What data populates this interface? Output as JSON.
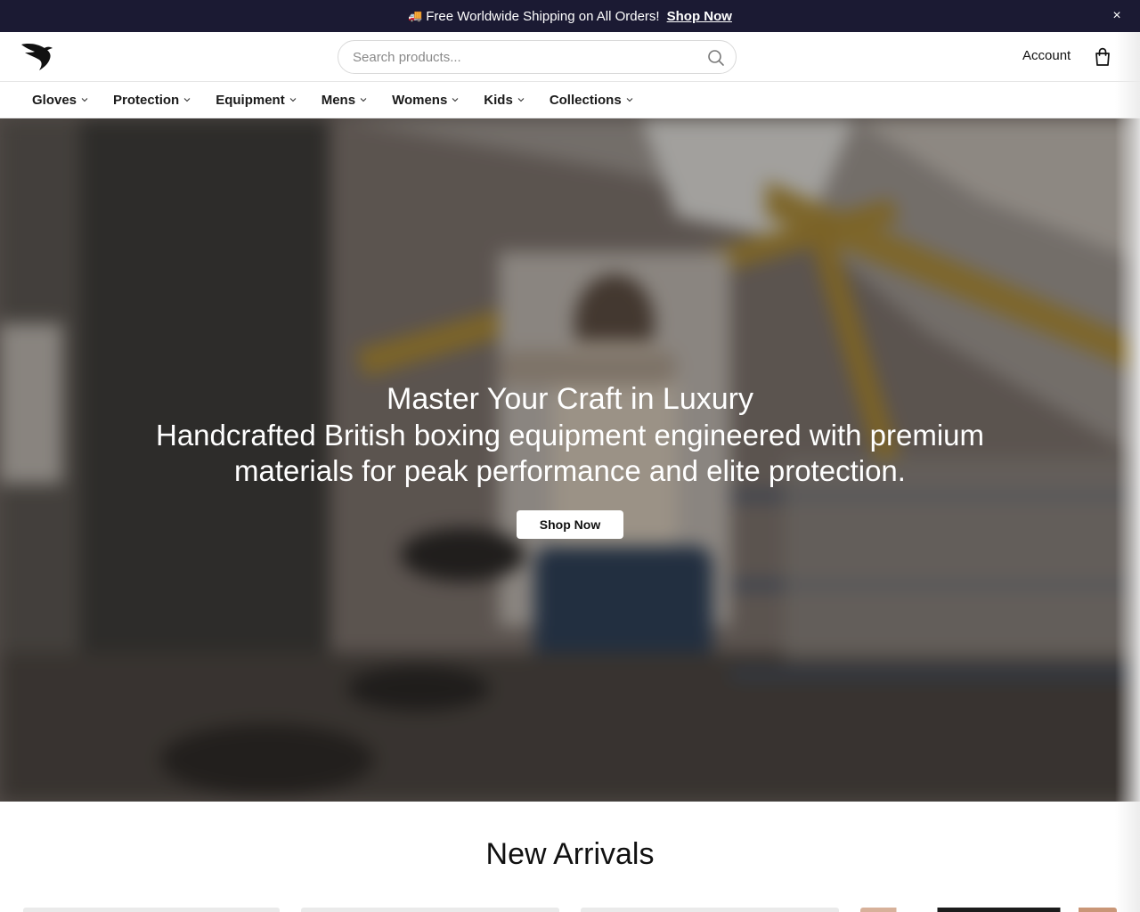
{
  "announcement": {
    "text": "Free Worldwide Shipping on All Orders!",
    "icon": "truck-icon",
    "link_label": "Shop Now",
    "close_label": "×"
  },
  "header": {
    "search_placeholder": "Search products...",
    "account_label": "Account",
    "cart_icon": "shopping-bag-icon",
    "logo_icon": "bird-logo-icon"
  },
  "nav": {
    "items": [
      {
        "label": "Gloves"
      },
      {
        "label": "Protection"
      },
      {
        "label": "Equipment"
      },
      {
        "label": "Mens"
      },
      {
        "label": "Womens"
      },
      {
        "label": "Kids"
      },
      {
        "label": "Collections"
      }
    ]
  },
  "hero": {
    "title": "Master Your Craft in Luxury",
    "subtitle": "Handcrafted British boxing equipment engineered with premium materials for peak performance and elite protection.",
    "button_label": "Shop Now"
  },
  "arrivals": {
    "title": "New Arrivals"
  },
  "colors": {
    "announcement_bg": "#1b1a33",
    "hero_overlay": "#000000",
    "text_primary": "#111111"
  }
}
